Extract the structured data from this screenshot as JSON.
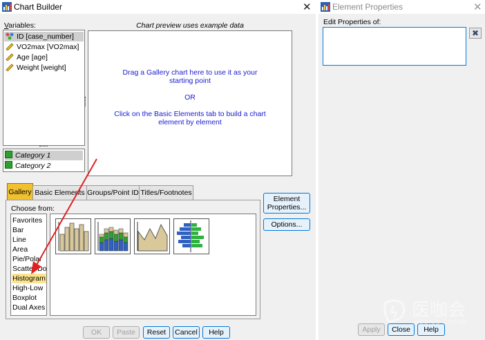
{
  "chart_builder": {
    "title": "Chart Builder",
    "variables_label": "Variables:",
    "preview_note": "Chart preview uses example data",
    "variables": [
      {
        "label": "ID [case_number]",
        "icon": "nominal-variable-icon"
      },
      {
        "label": "VO2max [VO2max]",
        "icon": "scale-variable-icon"
      },
      {
        "label": "Age [age]",
        "icon": "scale-variable-icon"
      },
      {
        "label": "Weight [weight]",
        "icon": "scale-variable-icon"
      }
    ],
    "categories": [
      "Category 1",
      "Category 2"
    ],
    "canvas_text": {
      "line1": "Drag a Gallery chart here to use it as your",
      "line2": "starting point",
      "or": "OR",
      "line3": "Click on the Basic Elements tab to build a chart",
      "line4": "element by element"
    },
    "tabs": [
      "Gallery",
      "Basic Elements",
      "Groups/Point ID",
      "Titles/Footnotes"
    ],
    "active_tab": "Gallery",
    "choose_from_label": "Choose from:",
    "gallery_types": [
      "Favorites",
      "Bar",
      "Line",
      "Area",
      "Pie/Polar",
      "Scatter/Dot",
      "Histogram",
      "High-Low",
      "Boxplot",
      "Dual Axes"
    ],
    "selected_type": "Histogram",
    "side_buttons": {
      "element_properties_l1": "Element",
      "element_properties_l2": "Properties...",
      "options": "Options..."
    },
    "bottom_buttons": {
      "ok": "OK",
      "paste": "Paste",
      "reset": "Reset",
      "cancel": "Cancel",
      "help": "Help"
    }
  },
  "element_properties": {
    "title": "Element Properties",
    "edit_label": "Edit Properties of:",
    "bottom_buttons": {
      "apply": "Apply",
      "close": "Close",
      "help": "Help"
    }
  },
  "watermark": {
    "text": "医咖会",
    "subtext": "MEDICO GROUP"
  },
  "colors": {
    "accent_tab": "#f0c030",
    "canvas_text": "#1a1ad0",
    "category_square": "#2ea02e",
    "arrow": "#e02020"
  }
}
